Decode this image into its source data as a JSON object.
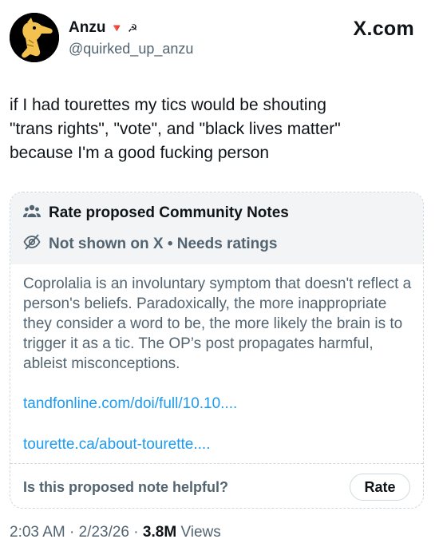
{
  "author": {
    "display_name": "Anzu",
    "handle": "@quirked_up_anzu",
    "badges": [
      "red-triangle-down-icon",
      "hammer-sickle-icon"
    ]
  },
  "brand": "X.com",
  "tweet": {
    "text": "if I had tourettes my tics would be shouting\n\"trans rights\", \"vote\", and \"black lives matter\"\nbecause I'm a good fucking person"
  },
  "community_note": {
    "title": "Rate proposed Community Notes",
    "title_icon": "people-icon",
    "status": "Not shown on X • Needs ratings",
    "status_icon": "eye-off-icon",
    "body": "Coprolalia is an involuntary symptom that doesn't reflect a person's beliefs. Paradoxically, the more inappropriate they consider a word to be, the more likely the brain is to trigger it as a tic. The OP’s post propagates harmful, ableist misconceptions.",
    "links": [
      "tandfonline.com/doi/full/10.10....",
      "tourette.ca/about-tourette...."
    ],
    "question": "Is this proposed note helpful?",
    "rate_label": "Rate"
  },
  "meta": {
    "time": "2:03 AM",
    "date": "2/23/26",
    "views_count": "3.8M",
    "views_label": "Views"
  },
  "colors": {
    "text_primary": "#0f1419",
    "text_secondary": "#536471",
    "link": "#1d9bf0",
    "border": "#cfd9de",
    "note_header_bg": "#f2f4f5",
    "avatar_bg": "#000000",
    "avatar_figure": "#f2c14e"
  }
}
